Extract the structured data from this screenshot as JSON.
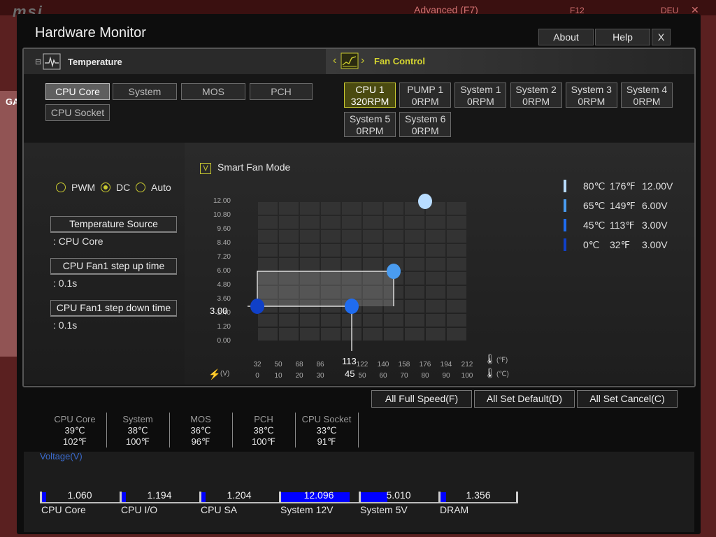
{
  "background": {
    "logo": "msi",
    "advanced": "Advanced (F7)",
    "f12": "F12",
    "lang": "DEU",
    "close": "✕",
    "side_label": "GA"
  },
  "window": {
    "title": "Hardware Monitor",
    "about": "About",
    "help": "Help",
    "close": "X"
  },
  "temperature_tab": {
    "label": "Temperature",
    "collapse": "⊟"
  },
  "fan_tab": {
    "prev": "‹",
    "next": "›",
    "label": "Fan Control"
  },
  "sources": [
    {
      "label": "CPU Core",
      "active": true
    },
    {
      "label": "System",
      "active": false
    },
    {
      "label": "MOS",
      "active": false
    },
    {
      "label": "PCH",
      "active": false
    },
    {
      "label": "CPU Socket",
      "active": false
    }
  ],
  "fans": [
    {
      "name": "CPU 1",
      "speed": "320RPM",
      "active": true
    },
    {
      "name": "PUMP 1",
      "speed": "0RPM",
      "active": false
    },
    {
      "name": "System 1",
      "speed": "0RPM",
      "active": false
    },
    {
      "name": "System 2",
      "speed": "0RPM",
      "active": false
    },
    {
      "name": "System 3",
      "speed": "0RPM",
      "active": false
    },
    {
      "name": "System 4",
      "speed": "0RPM",
      "active": false
    },
    {
      "name": "System 5",
      "speed": "0RPM",
      "active": false
    },
    {
      "name": "System 6",
      "speed": "0RPM",
      "active": false
    }
  ],
  "mode": {
    "options": [
      {
        "label": "PWM",
        "selected": false
      },
      {
        "label": "DC",
        "selected": true
      },
      {
        "label": "Auto",
        "selected": false
      }
    ]
  },
  "settings": {
    "temp_source_label": "Temperature Source",
    "temp_source_value": ": CPU Core",
    "step_up_label": "CPU Fan1 step up time",
    "step_up_value": ": 0.1s",
    "step_down_label": "CPU Fan1 step down time",
    "step_down_value": ": 0.1s"
  },
  "smart_fan": {
    "checked": true,
    "check_mark": "V",
    "label": "Smart Fan Mode"
  },
  "chart_data": {
    "type": "line",
    "y_ticks": [
      "12.00",
      "10.80",
      "9.60",
      "8.40",
      "7.20",
      "6.00",
      "4.80",
      "3.60",
      "2.40",
      "1.20",
      "0.00"
    ],
    "x_ticks_f": [
      "32",
      "50",
      "68",
      "86",
      "104",
      "122",
      "140",
      "158",
      "176",
      "194",
      "212"
    ],
    "x_ticks_c": [
      "0",
      "10",
      "20",
      "30",
      "40",
      "50",
      "60",
      "70",
      "80",
      "90",
      "100"
    ],
    "ylim": [
      0,
      12
    ],
    "xlim": [
      0,
      100
    ],
    "points": [
      {
        "c": 0,
        "v": 3.0
      },
      {
        "c": 45,
        "v": 3.0
      },
      {
        "c": 65,
        "v": 6.0
      },
      {
        "c": 80,
        "v": 12.0
      }
    ],
    "cursor": {
      "v_label": "3.00",
      "f_label": "113",
      "c_label": "45"
    },
    "unit_f": "(℉)",
    "unit_c": "(℃)",
    "volt_unit": "(V)"
  },
  "legend": [
    {
      "c": "80℃",
      "f": "176℉",
      "v": "12.00V",
      "color": "#b8dcff"
    },
    {
      "c": "65℃",
      "f": "149℉",
      "v": "6.00V",
      "color": "#4a9cf0"
    },
    {
      "c": "45℃",
      "f": "113℉",
      "v": "3.00V",
      "color": "#1f6cf0"
    },
    {
      "c": "0℃",
      "f": "32℉",
      "v": "3.00V",
      "color": "#1040c8"
    }
  ],
  "actions": {
    "full_speed": "All Full Speed(F)",
    "set_default": "All Set Default(D)",
    "set_cancel": "All Set Cancel(C)"
  },
  "temps": [
    {
      "name": "CPU Core",
      "c": "39℃",
      "f": "102℉"
    },
    {
      "name": "System",
      "c": "38℃",
      "f": "100℉"
    },
    {
      "name": "MOS",
      "c": "36℃",
      "f": "96℉"
    },
    {
      "name": "PCH",
      "c": "38℃",
      "f": "100℉"
    },
    {
      "name": "CPU Socket",
      "c": "33℃",
      "f": "91℉"
    }
  ],
  "voltage": {
    "label": "Voltage(V)",
    "items": [
      {
        "name": "CPU Core",
        "value": "1.060",
        "level": 0.06
      },
      {
        "name": "CPU I/O",
        "value": "1.194",
        "level": 0.06
      },
      {
        "name": "CPU SA",
        "value": "1.204",
        "level": 0.06
      },
      {
        "name": "System 12V",
        "value": "12.096",
        "level": 0.98
      },
      {
        "name": "System 5V",
        "value": "5.010",
        "level": 0.38
      },
      {
        "name": "DRAM",
        "value": "1.356",
        "level": 0.08
      }
    ]
  }
}
